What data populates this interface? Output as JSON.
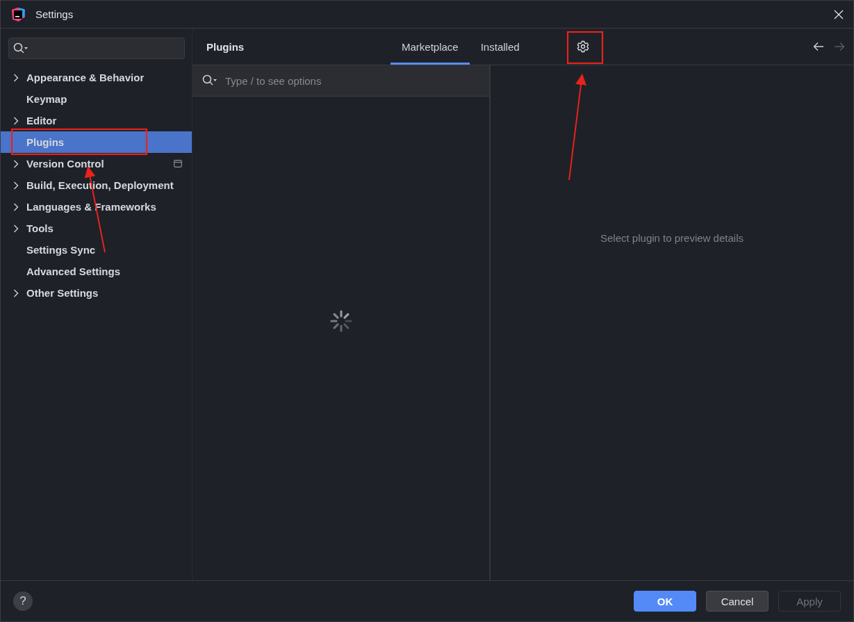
{
  "window": {
    "title": "Settings"
  },
  "sidebar": {
    "items": [
      {
        "label": "Appearance & Behavior",
        "kind": "group",
        "selected": false,
        "project_scoped": false
      },
      {
        "label": "Keymap",
        "kind": "page",
        "selected": false,
        "project_scoped": false
      },
      {
        "label": "Editor",
        "kind": "group",
        "selected": false,
        "project_scoped": false
      },
      {
        "label": "Plugins",
        "kind": "page",
        "selected": true,
        "project_scoped": false
      },
      {
        "label": "Version Control",
        "kind": "group",
        "selected": false,
        "project_scoped": true
      },
      {
        "label": "Build, Execution, Deployment",
        "kind": "group",
        "selected": false,
        "project_scoped": false
      },
      {
        "label": "Languages & Frameworks",
        "kind": "group",
        "selected": false,
        "project_scoped": false
      },
      {
        "label": "Tools",
        "kind": "group",
        "selected": false,
        "project_scoped": false
      },
      {
        "label": "Settings Sync",
        "kind": "page",
        "selected": false,
        "project_scoped": false
      },
      {
        "label": "Advanced Settings",
        "kind": "page",
        "selected": false,
        "project_scoped": false
      },
      {
        "label": "Other Settings",
        "kind": "group",
        "selected": false,
        "project_scoped": false
      }
    ]
  },
  "page": {
    "title": "Plugins",
    "tabs": [
      {
        "label": "Marketplace",
        "selected": true
      },
      {
        "label": "Installed",
        "selected": false
      }
    ],
    "nav": {
      "back_disabled": false,
      "forward_disabled": true
    },
    "search": {
      "placeholder": "Type / to see options"
    },
    "details": "Select plugin to preview details"
  },
  "footer": {
    "help": "?",
    "buttons": [
      {
        "label": "OK",
        "kind": "primary",
        "disabled": false
      },
      {
        "label": "Cancel",
        "kind": "normal",
        "disabled": false
      },
      {
        "label": "Apply",
        "kind": "normal",
        "disabled": true
      }
    ]
  }
}
